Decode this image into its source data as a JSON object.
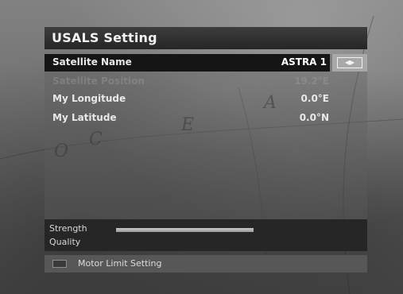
{
  "window": {
    "title": "USALS Setting"
  },
  "settings": [
    {
      "label": "Satellite Name",
      "value": "ASTRA 1"
    },
    {
      "label": "Satellite Position",
      "value": "19.2°E"
    },
    {
      "label": "My Longitude",
      "value": "0.0°E"
    },
    {
      "label": "My Latitude",
      "value": "0.0°N"
    }
  ],
  "selector": {
    "icon": "left-right-arrows-icon",
    "glyph": "◀▶"
  },
  "signal": {
    "strength_label": "Strength",
    "quality_label": "Quality",
    "strength_fraction": 0.55,
    "quality_fraction": 0.0
  },
  "footer": {
    "key_color": "#3a3a3a",
    "label": "Motor Limit Setting"
  }
}
